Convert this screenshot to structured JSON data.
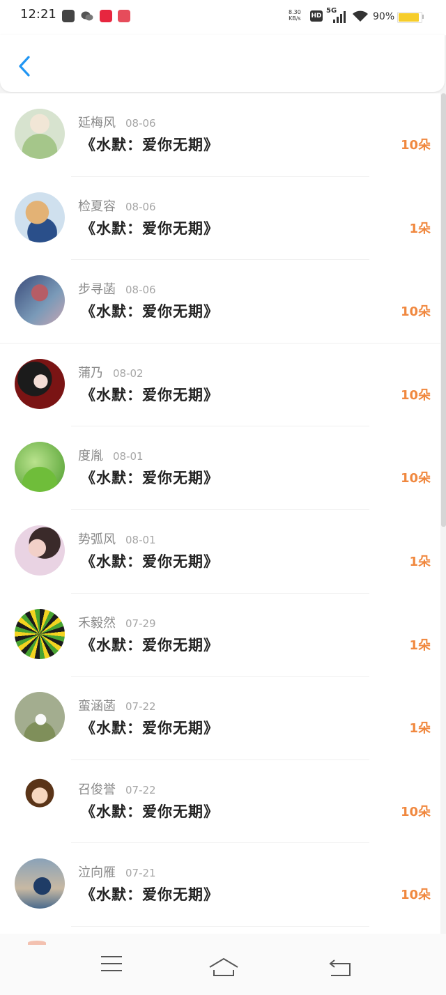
{
  "status_bar": {
    "time": "12:21",
    "network_speed_value": "8.30",
    "network_speed_unit": "KB/s",
    "hd": "HD",
    "network": "5G",
    "battery": "90%",
    "battery_level": 0.9
  },
  "header": {
    "back_icon": "chevron-left-icon",
    "accent": "#2196f3"
  },
  "rows": [
    {
      "name": "延梅风",
      "date": "08-06",
      "book": "《水默：爱你无期》",
      "amount": "10朵",
      "avatar": "avatar-1"
    },
    {
      "name": "检夏容",
      "date": "08-06",
      "book": "《水默：爱你无期》",
      "amount": "1朵",
      "avatar": "avatar-2"
    },
    {
      "name": "步寻菡",
      "date": "08-06",
      "book": "《水默：爱你无期》",
      "amount": "10朵",
      "avatar": "avatar-3"
    },
    {
      "name": "蒲乃",
      "date": "08-02",
      "book": "《水默：爱你无期》",
      "amount": "10朵",
      "avatar": "avatar-4"
    },
    {
      "name": "度胤",
      "date": "08-01",
      "book": "《水默：爱你无期》",
      "amount": "10朵",
      "avatar": "avatar-5"
    },
    {
      "name": "势弧风",
      "date": "08-01",
      "book": "《水默：爱你无期》",
      "amount": "1朵",
      "avatar": "avatar-6"
    },
    {
      "name": "禾毅然",
      "date": "07-29",
      "book": "《水默：爱你无期》",
      "amount": "1朵",
      "avatar": "avatar-7"
    },
    {
      "name": "蛮涵菡",
      "date": "07-22",
      "book": "《水默：爱你无期》",
      "amount": "1朵",
      "avatar": "avatar-8"
    },
    {
      "name": "召俊誉",
      "date": "07-22",
      "book": "《水默：爱你无期》",
      "amount": "10朵",
      "avatar": "avatar-9"
    },
    {
      "name": "泣向雁",
      "date": "07-21",
      "book": "《水默：爱你无期》",
      "amount": "10朵",
      "avatar": "avatar-10"
    }
  ],
  "colors": {
    "amount": "#f0883f",
    "name": "#8a8a8a",
    "book": "#222222"
  },
  "nav": {
    "menu_icon": "menu-icon",
    "home_icon": "home-icon",
    "back_icon": "back-icon"
  }
}
